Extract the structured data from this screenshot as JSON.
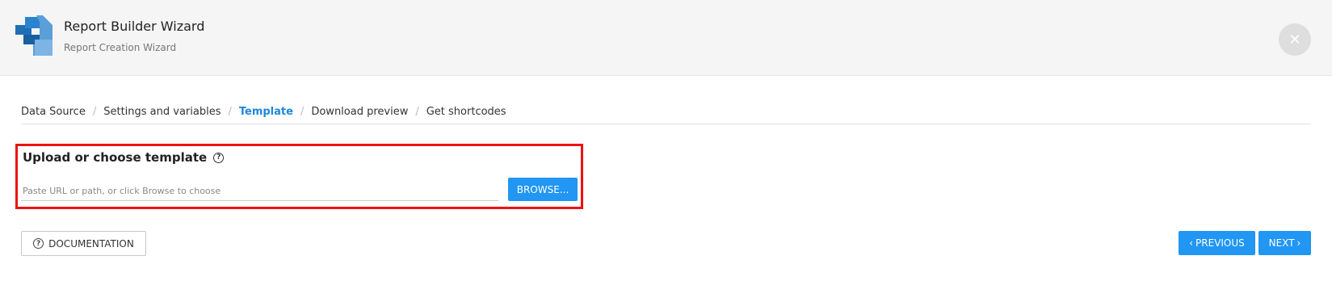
{
  "header": {
    "title": "Report Builder Wizard",
    "subtitle": "Report Creation Wizard",
    "logo_icon": "report-builder-logo-icon",
    "close_icon": "close-icon",
    "close_symbol": "✕"
  },
  "breadcrumb": {
    "items": [
      {
        "label": "Data Source",
        "active": false
      },
      {
        "label": "Settings and variables",
        "active": false
      },
      {
        "label": "Template",
        "active": true
      },
      {
        "label": "Download preview",
        "active": false
      },
      {
        "label": "Get shortcodes",
        "active": false
      }
    ],
    "separator": "/"
  },
  "template_section": {
    "title": "Upload or choose template",
    "help_symbol": "?",
    "input_value": "",
    "input_placeholder": "Paste URL or path, or click Browse to choose",
    "browse_label": "BROWSE..."
  },
  "footer": {
    "documentation_label": "DOCUMENTATION",
    "previous_label": "PREVIOUS",
    "next_label": "NEXT",
    "chevron_left": "‹",
    "chevron_right": "›"
  },
  "colors": {
    "accent": "#2196f3",
    "active_crumb": "#1e88d9",
    "highlight_border": "#ee1111",
    "header_bg": "#f5f5f5"
  }
}
